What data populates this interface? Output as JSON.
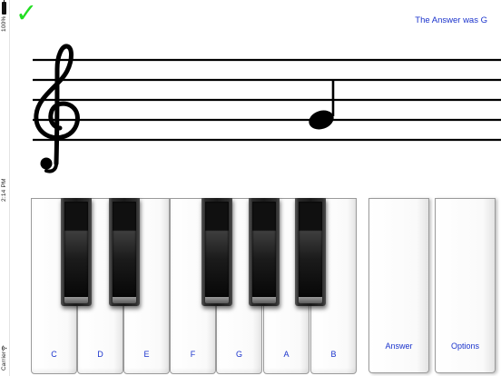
{
  "status_bar": {
    "battery": "100%",
    "time": "2:14 PM",
    "carrier": "Carrier"
  },
  "feedback": {
    "result_icon": "checkmark-icon",
    "result_symbol": "✓",
    "result_color": "#22dd22",
    "answer_text": "The Answer was G"
  },
  "staff": {
    "clef": "treble",
    "note": "G4",
    "note_duration": "quarter"
  },
  "keyboard": {
    "white_keys": [
      {
        "label": "C"
      },
      {
        "label": "D"
      },
      {
        "label": "E"
      },
      {
        "label": "F"
      },
      {
        "label": "G"
      },
      {
        "label": "A"
      },
      {
        "label": "B"
      }
    ],
    "black_keys": [
      "C#",
      "D#",
      "F#",
      "G#",
      "A#"
    ]
  },
  "buttons": {
    "answer_label": "Answer",
    "options_label": "Options"
  },
  "colors": {
    "label_blue": "#1a33cc",
    "correct_green": "#22dd22"
  }
}
